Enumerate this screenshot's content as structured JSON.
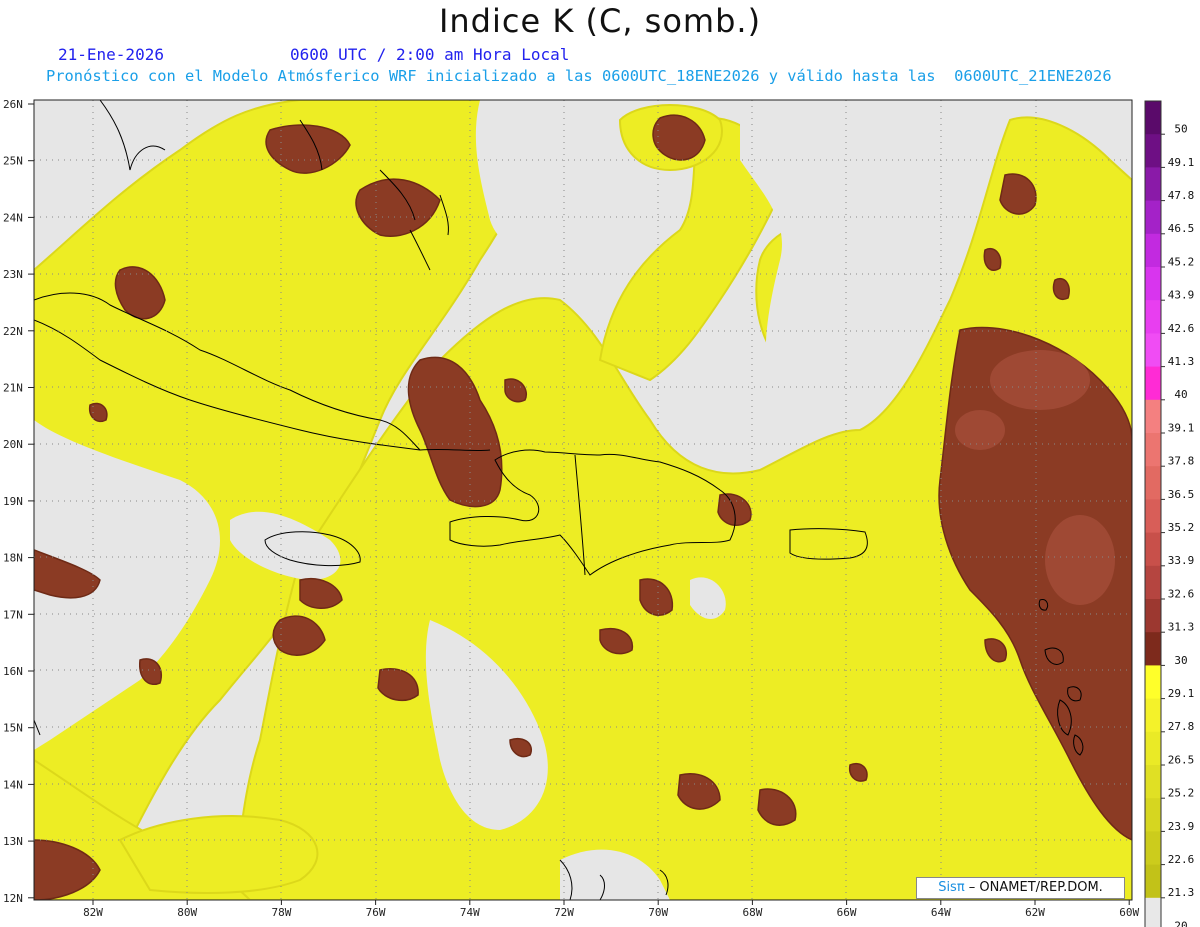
{
  "title": "Indice K (C, somb.)",
  "date_label": "21-Ene-2026",
  "time_label": "0600 UTC / 2:00 am Hora Local",
  "model_label": "Pronóstico con el Modelo Atmósferico WRF inicializado a las 0600UTC_18ENE2026 y válido hasta las  0600UTC_21ENE2026",
  "lat_ticks": [
    "26N",
    "25N",
    "24N",
    "23N",
    "22N",
    "21N",
    "20N",
    "19N",
    "18N",
    "17N",
    "16N",
    "15N",
    "14N",
    "13N",
    "12N"
  ],
  "lon_ticks": [
    "82W",
    "80W",
    "78W",
    "76W",
    "74W",
    "72W",
    "70W",
    "68W",
    "66W",
    "64W",
    "62W",
    "60W"
  ],
  "colorbar": {
    "labels": [
      "50",
      "49.1",
      "47.8",
      "46.5",
      "45.2",
      "43.9",
      "42.6",
      "41.3",
      "40",
      "39.1",
      "37.8",
      "36.5",
      "35.2",
      "33.9",
      "32.6",
      "31.3",
      "30",
      "29.1",
      "27.8",
      "26.5",
      "25.2",
      "23.9",
      "22.6",
      "21.3",
      "20"
    ],
    "colors": [
      "#5a0a6a",
      "#6e0f84",
      "#8a1aa8",
      "#a422c8",
      "#c22ae0",
      "#d835ee",
      "#e83ef0",
      "#f04cf4",
      "#ff2bd5",
      "#f48080",
      "#ec7570",
      "#e26a62",
      "#d85e58",
      "#c8504a",
      "#b54540",
      "#9c3830",
      "#7d2a1c",
      "#ffff2a",
      "#f4f22a",
      "#eaea26",
      "#e0e024",
      "#d6d620",
      "#cccc1c",
      "#c2c218",
      "#e8e8e8"
    ]
  },
  "credit": {
    "logo": "Sisπ",
    "text": " – ONAMET/REP.DOM."
  },
  "colors": {
    "background": "#e6e6e6",
    "yellow": "#eeee22",
    "dark_yellow": "#d8d418",
    "brown": "#8a3a24",
    "coast": "#000000"
  }
}
